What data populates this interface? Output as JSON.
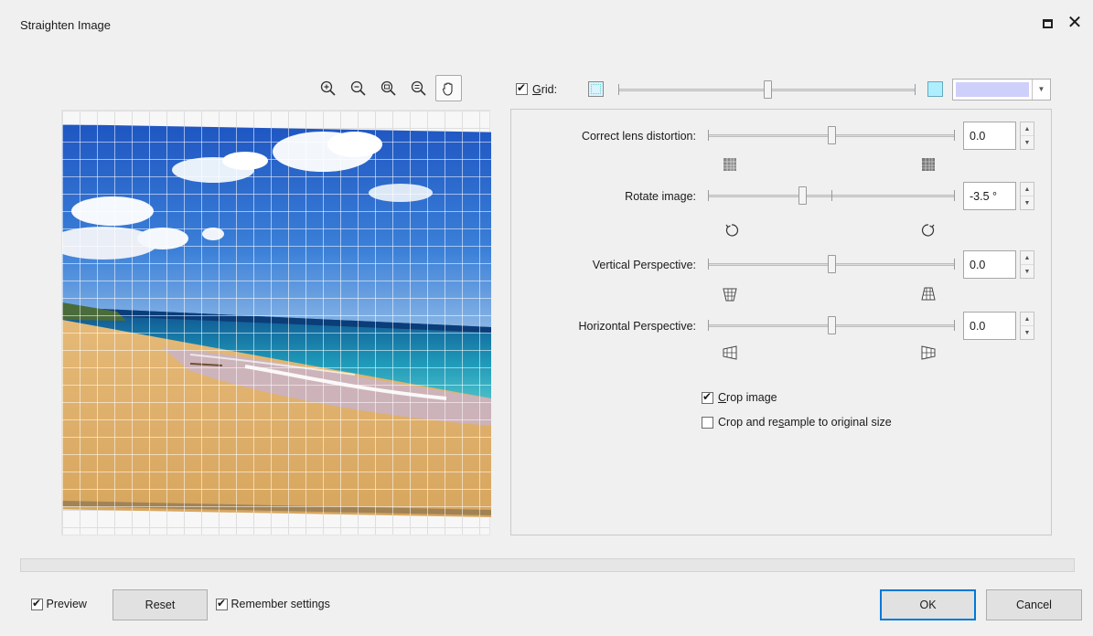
{
  "window": {
    "title": "Straighten Image",
    "maximize_icon": "maximize-icon",
    "close_symbol": "✕"
  },
  "zoom_tools": [
    {
      "name": "zoom-in-icon",
      "active": false
    },
    {
      "name": "zoom-out-icon",
      "active": false
    },
    {
      "name": "zoom-to-fit-icon",
      "active": false
    },
    {
      "name": "zoom-actual-size-icon",
      "active": false
    },
    {
      "name": "hand-pan-icon",
      "active": true
    }
  ],
  "grid": {
    "checked": true,
    "label_prefix": "",
    "label_accel": "G",
    "label_rest": "rid:",
    "size_slider_position": 0.5,
    "color_value": "#cfcffb"
  },
  "settings": {
    "lens_distortion": {
      "label": "Correct lens distortion:",
      "value": "0.0",
      "slider_position": 0.5
    },
    "rotate": {
      "label": "Rotate image:",
      "value": "-3.5 °",
      "slider_position": 0.38
    },
    "vertical": {
      "label": "Vertical Perspective:",
      "value": "0.0",
      "slider_position": 0.5
    },
    "horizontal": {
      "label": "Horizontal Perspective:",
      "value": "0.0",
      "slider_position": 0.5
    },
    "crop_image": {
      "checked": true,
      "accel": "C",
      "rest": "rop image"
    },
    "crop_resample": {
      "checked": false,
      "pre": "Crop and re",
      "accel": "s",
      "rest": "ample to original size"
    }
  },
  "footer": {
    "preview": {
      "checked": true,
      "label": "Preview"
    },
    "reset_label": "Reset",
    "remember": {
      "checked": true,
      "label": "Remember settings"
    },
    "ok_label": "OK",
    "cancel_label": "Cancel"
  }
}
